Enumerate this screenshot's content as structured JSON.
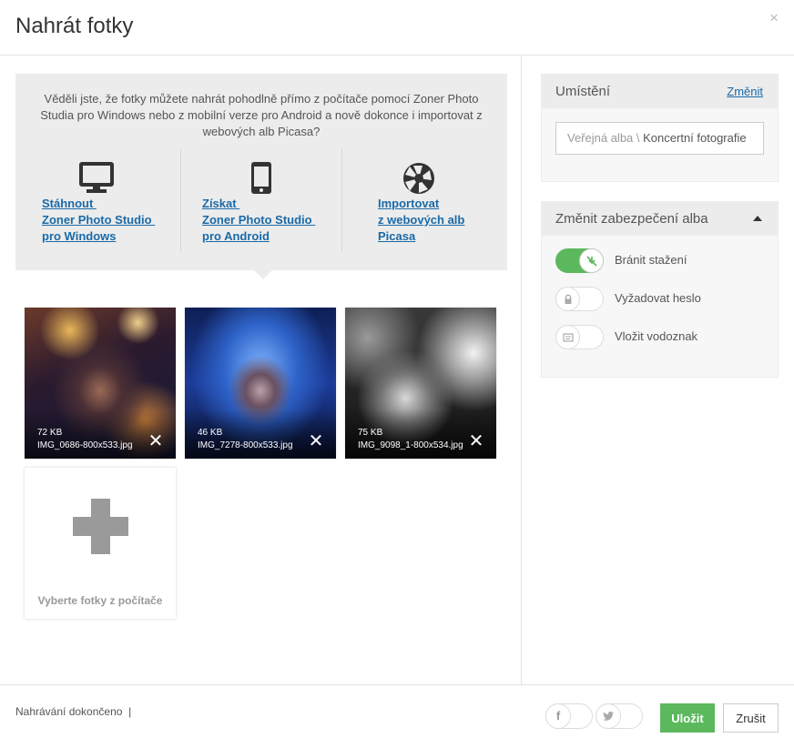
{
  "dialog": {
    "title": "Nahrát fotky",
    "close_label": "×"
  },
  "promo": {
    "text": "Věděli jste, že fotky můžete nahrát pohodlně přímo z počítače pomocí Zoner Photo Studia pro Windows nebo z mobilní verze pro Android a nově dokonce i importovat z webových alb Picasa?",
    "items": [
      {
        "icon": "monitor-icon",
        "line1": "Stáhnout ",
        "line2": "Zoner Photo Studio ",
        "line3": "pro Windows"
      },
      {
        "icon": "smartphone-icon",
        "line1": "Získat ",
        "line2": "Zoner Photo Studio ",
        "line3": "pro Android"
      },
      {
        "icon": "picasa-icon",
        "line1": "Importovat",
        "line2": "z webových alb",
        "line3": "Picasa"
      }
    ]
  },
  "photos": [
    {
      "size": "72 KB",
      "filename": "IMG_0686-800x533.jpg",
      "remove_label": "✕"
    },
    {
      "size": "46 KB",
      "filename": "IMG_7278-800x533.jpg",
      "remove_label": "✕"
    },
    {
      "size": "75 KB",
      "filename": "IMG_9098_1-800x534.jpg",
      "remove_label": "✕"
    }
  ],
  "add_photos": {
    "label": "Vyberte fotky z počítače"
  },
  "location": {
    "title": "Umístění",
    "change_link": "Změnit",
    "path_parent": "Veřejná alba \\",
    "path_album": "Koncertní fotografie"
  },
  "security": {
    "title": "Změnit zabezpečení alba",
    "options": [
      {
        "label": "Bránit stažení",
        "state": "on",
        "icon": "no-download-icon"
      },
      {
        "label": "Vyžadovat heslo",
        "state": "off",
        "icon": "lock-icon"
      },
      {
        "label": "Vložit vodoznak",
        "state": "off",
        "icon": "watermark-icon"
      }
    ]
  },
  "footer": {
    "status": "Nahrávání dokončeno  |",
    "facebook_icon": "f",
    "twitter_icon": "t",
    "save_label": "Uložit",
    "cancel_label": "Zrušit"
  },
  "colors": {
    "accent_green": "#5cb85c",
    "link_blue": "#1a6aa8",
    "panel_gray": "#ececec"
  }
}
